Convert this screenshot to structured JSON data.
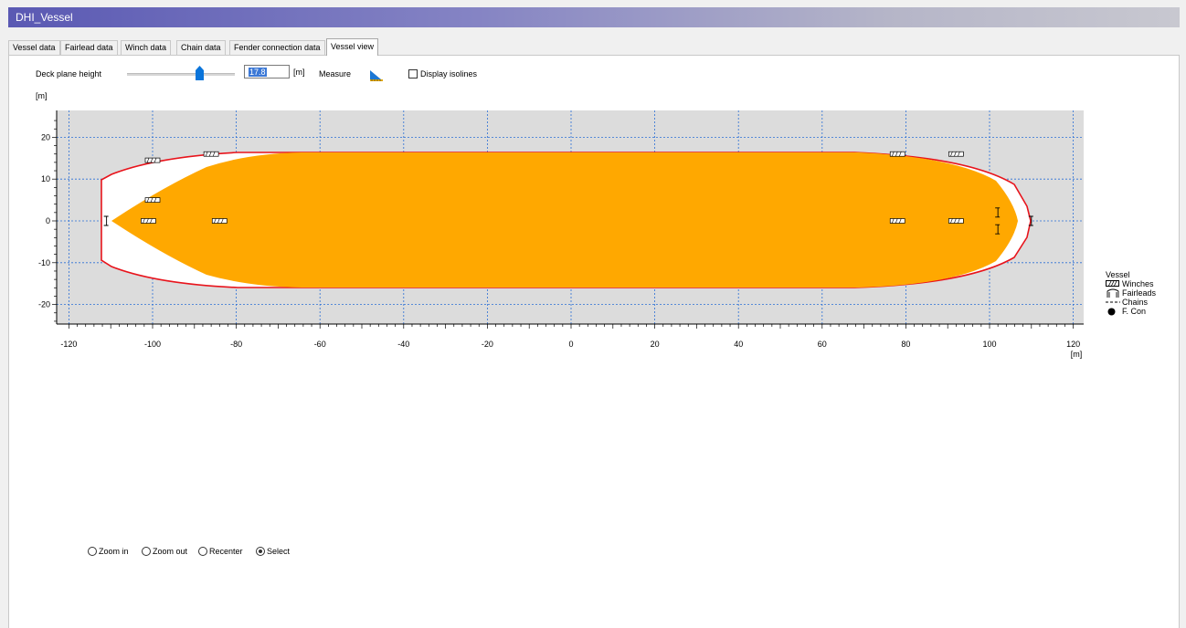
{
  "window": {
    "title": "DHI_Vessel"
  },
  "tabs": [
    {
      "label": "Vessel data",
      "active": false
    },
    {
      "label": "Fairlead data",
      "active": false
    },
    {
      "label": "Winch data",
      "active": false
    },
    {
      "label": "Chain data",
      "active": false
    },
    {
      "label": "Fender connection data",
      "active": false
    },
    {
      "label": "Vessel view",
      "active": true
    }
  ],
  "controls": {
    "deck_plane_label": "Deck plane height",
    "deck_plane_value": "17.8",
    "deck_plane_unit": "[m]",
    "measure_label": "Measure",
    "isolines_label": "Display isolines",
    "isolines_checked": false
  },
  "chart_data": {
    "type": "diagram",
    "y_unit": "[m]",
    "x_unit": "[m]",
    "xlim": [
      -121,
      121
    ],
    "ylim": [
      -26,
      26
    ],
    "x_ticks": [
      -120,
      -100,
      -80,
      -60,
      -40,
      -20,
      0,
      20,
      40,
      60,
      80,
      100,
      120
    ],
    "y_ticks": [
      20,
      10,
      0,
      -10,
      -20
    ],
    "grid": true,
    "colors": {
      "outline": "#e8141c",
      "deck_area": "#ffa800",
      "background": "#dcdcdc",
      "grid": "#2a6fd6"
    },
    "winches": [
      [
        -100,
        14.5
      ],
      [
        -86,
        16
      ],
      [
        78,
        16
      ],
      [
        92,
        16
      ],
      [
        -100,
        5
      ],
      [
        -84,
        0
      ],
      [
        78,
        0
      ],
      [
        92,
        0
      ],
      [
        -101,
        0
      ]
    ],
    "fairleads": [
      [
        -111,
        0
      ],
      [
        110,
        0
      ],
      [
        102,
        2
      ],
      [
        102,
        -2
      ]
    ]
  },
  "legend": {
    "title": "Vessel",
    "items": [
      {
        "label": "Winches",
        "icon": "winch-icon"
      },
      {
        "label": "Fairleads",
        "icon": "fairlead-icon"
      },
      {
        "label": "Chains",
        "icon": "chain-icon"
      },
      {
        "label": "F. Con",
        "icon": "fender-connection-icon"
      }
    ]
  },
  "tools": [
    {
      "label": "Zoom in",
      "selected": false
    },
    {
      "label": "Zoom out",
      "selected": false
    },
    {
      "label": "Recenter",
      "selected": false
    },
    {
      "label": "Select",
      "selected": true
    }
  ]
}
